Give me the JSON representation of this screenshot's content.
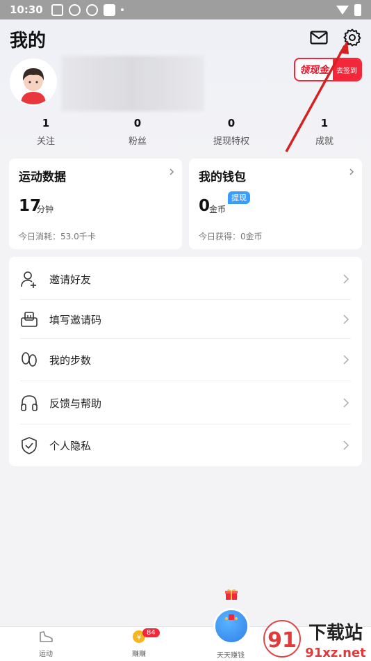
{
  "status_bar": {
    "time": "10:30"
  },
  "header": {
    "title": "我的"
  },
  "promo": {
    "left_label": "领现金",
    "right_label": "去签到"
  },
  "stats": [
    {
      "value": "1",
      "label": "关注"
    },
    {
      "value": "0",
      "label": "粉丝"
    },
    {
      "value": "0",
      "label": "提现特权"
    },
    {
      "value": "1",
      "label": "成就"
    }
  ],
  "sport_card": {
    "title": "运动数据",
    "value": "17",
    "unit": "分钟",
    "sub": "今日消耗：53.0千卡"
  },
  "wallet_card": {
    "title": "我的钱包",
    "tag": "提现",
    "value": "0",
    "unit": "金币",
    "sub": "今日获得：0金币"
  },
  "menu": [
    {
      "label": "邀请好友",
      "icon": "invite-friend-icon"
    },
    {
      "label": "填写邀请码",
      "icon": "invite-code-icon"
    },
    {
      "label": "我的步数",
      "icon": "footprint-icon"
    },
    {
      "label": "反馈与帮助",
      "icon": "headset-icon"
    },
    {
      "label": "个人隐私",
      "icon": "shield-check-icon"
    }
  ],
  "bottom_nav": [
    {
      "label": "运动",
      "icon": "shoe-icon"
    },
    {
      "label": "赚赚",
      "icon": "coin-icon",
      "badge": "84"
    },
    {
      "label": "天天赚钱",
      "icon": "earn-ball-icon"
    }
  ],
  "watermark": {
    "text_cn": "下载站",
    "text_url": "91xz.net",
    "logo": "91"
  },
  "colors": {
    "accent_red": "#f2273a",
    "accent_blue": "#3b9dfb",
    "annotation_arrow": "#d42222"
  }
}
